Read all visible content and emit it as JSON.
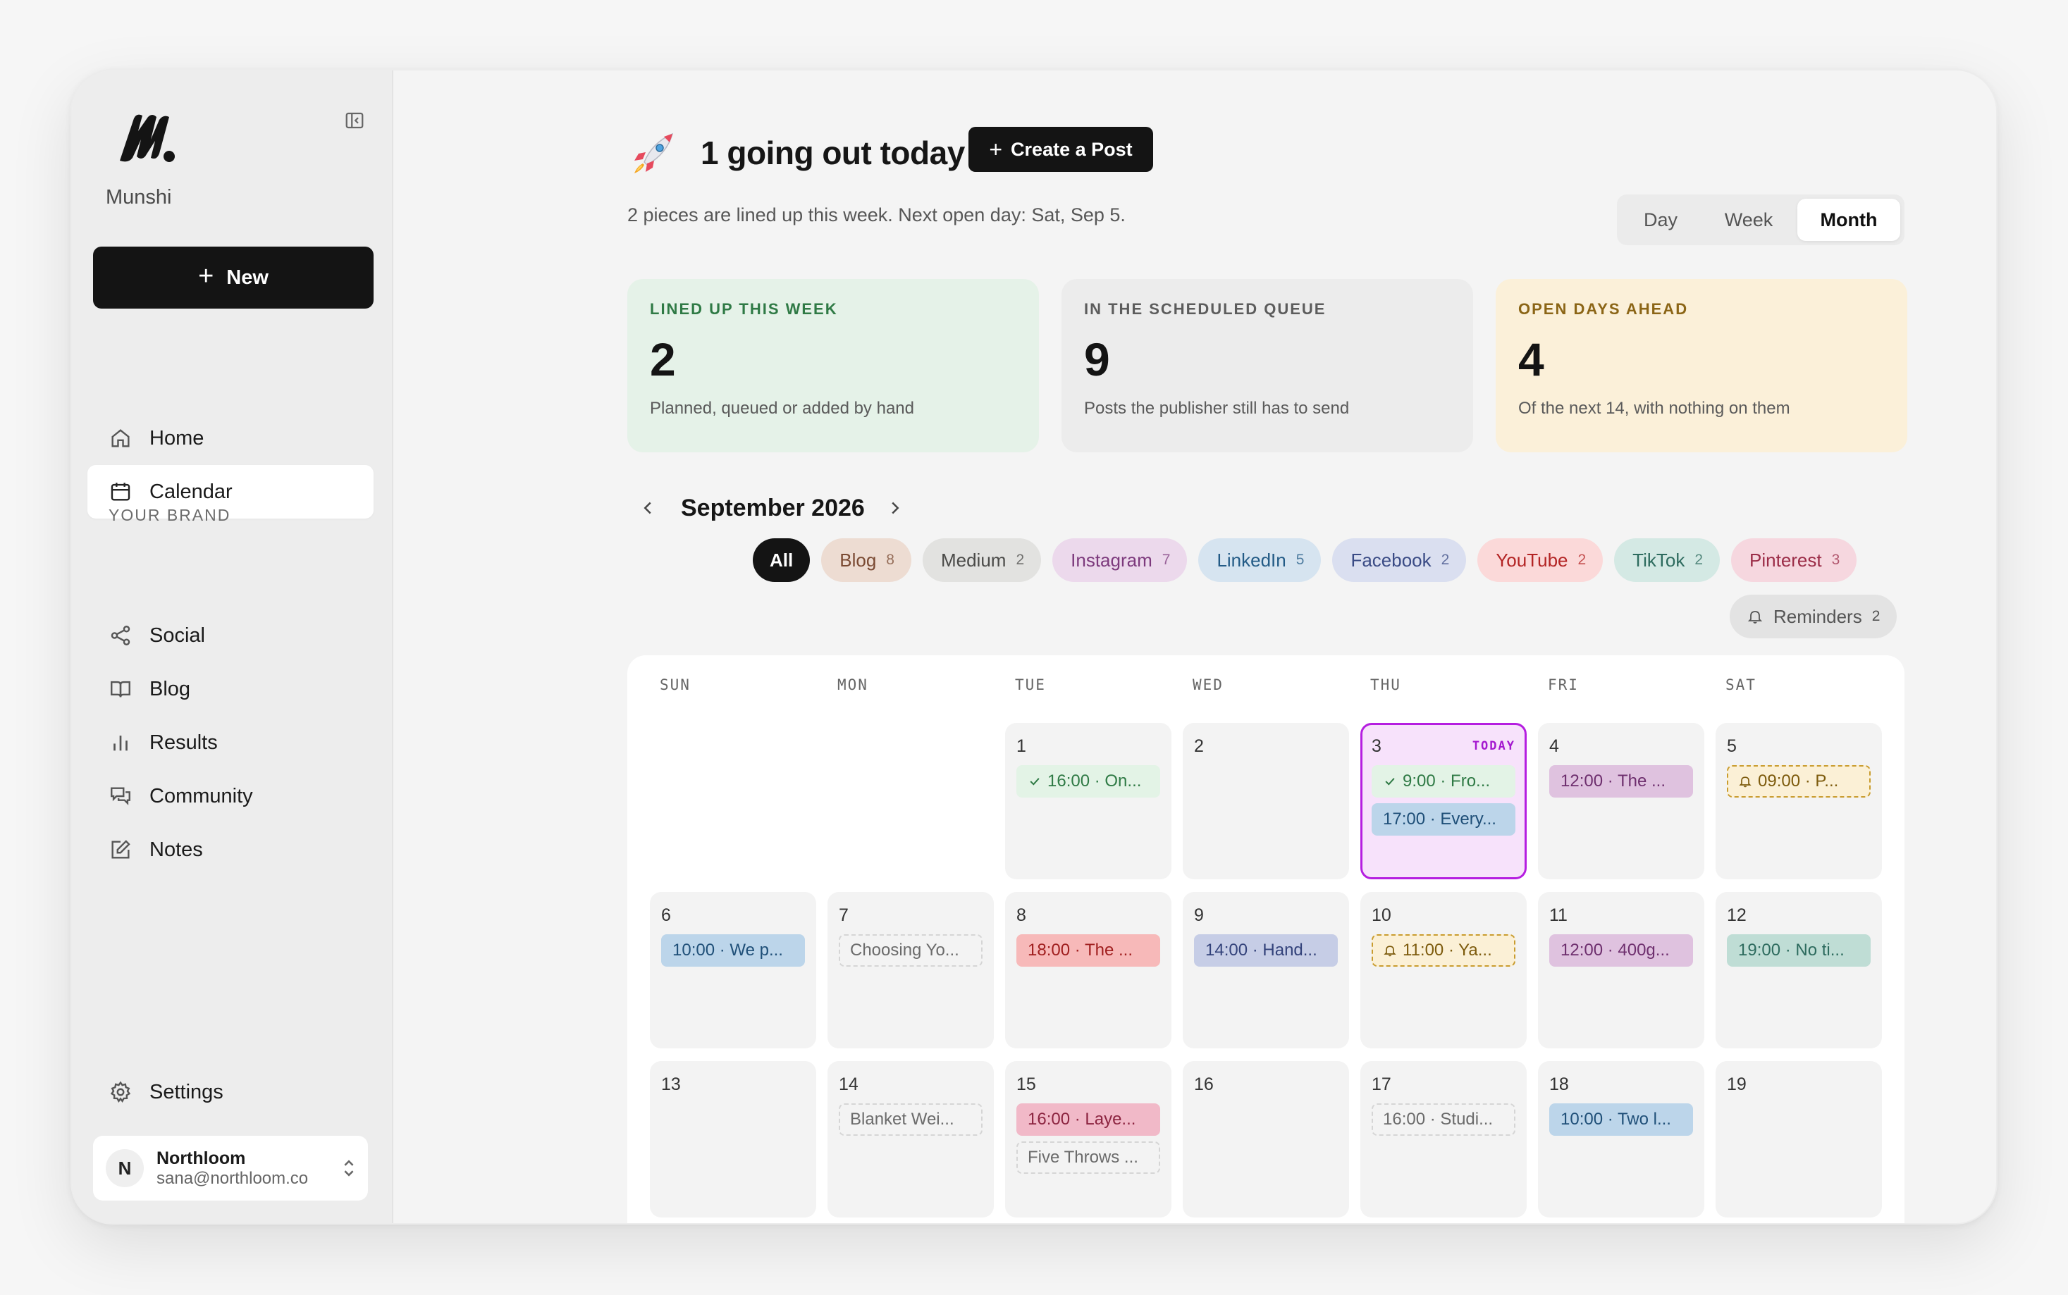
{
  "sidebar": {
    "brand_name": "Munshi",
    "new_label": "New",
    "nav": [
      {
        "label": "Home",
        "icon": "home-icon"
      },
      {
        "label": "Calendar",
        "icon": "calendar-icon",
        "active": true
      }
    ],
    "section_label": "YOUR BRAND",
    "brand_nav": [
      {
        "label": "Social",
        "icon": "share-icon"
      },
      {
        "label": "Blog",
        "icon": "book-icon"
      },
      {
        "label": "Results",
        "icon": "bar-chart-icon"
      },
      {
        "label": "Community",
        "icon": "chat-icon"
      },
      {
        "label": "Notes",
        "icon": "edit-icon"
      }
    ],
    "settings_label": "Settings",
    "account": {
      "initial": "N",
      "name": "Northloom",
      "email": "sana@northloom.co"
    }
  },
  "header": {
    "headline": "1 going out today",
    "create_label": "Create a Post",
    "subline": "2 pieces are lined up this week. Next open day: Sat, Sep 5.",
    "views": [
      "Day",
      "Week",
      "Month"
    ],
    "active_view": "Month"
  },
  "stats": [
    {
      "label": "LINED UP THIS WEEK",
      "value": "2",
      "desc": "Planned, queued or added by hand"
    },
    {
      "label": "IN THE SCHEDULED QUEUE",
      "value": "9",
      "desc": "Posts the publisher still has to send"
    },
    {
      "label": "OPEN DAYS AHEAD",
      "value": "4",
      "desc": "Of the next 14, with nothing on them"
    }
  ],
  "calendar": {
    "month_title": "September 2026",
    "filters": [
      {
        "label": "All",
        "count": "",
        "bg": "#141414",
        "fg": "#ffffff"
      },
      {
        "label": "Blog",
        "count": "8",
        "bg": "#eddcd2",
        "fg": "#7a4a33"
      },
      {
        "label": "Medium",
        "count": "2",
        "bg": "#e2e2e0",
        "fg": "#4a4a48"
      },
      {
        "label": "Instagram",
        "count": "7",
        "bg": "#ecd9ec",
        "fg": "#7d3a7d"
      },
      {
        "label": "LinkedIn",
        "count": "5",
        "bg": "#d6e4f0",
        "fg": "#235b86"
      },
      {
        "label": "Facebook",
        "count": "2",
        "bg": "#dadff0",
        "fg": "#3a4b85"
      },
      {
        "label": "YouTube",
        "count": "2",
        "bg": "#fbd9d9",
        "fg": "#b32424"
      },
      {
        "label": "TikTok",
        "count": "2",
        "bg": "#d4e9e4",
        "fg": "#2d6b5e"
      },
      {
        "label": "Pinterest",
        "count": "3",
        "bg": "#f6d7df",
        "fg": "#9b2c47"
      }
    ],
    "reminders": {
      "label": "Reminders",
      "count": "2"
    },
    "weekdays": [
      "SUN",
      "MON",
      "TUE",
      "WED",
      "THU",
      "FRI",
      "SAT"
    ],
    "today_tag": "TODAY",
    "weeks": [
      [
        null,
        null,
        {
          "day": "1",
          "events": [
            {
              "text": "16:00 · On...",
              "kind": "done",
              "bg": "#e3f3e6",
              "fg": "#2f7a45"
            }
          ]
        },
        {
          "day": "2",
          "events": []
        },
        {
          "day": "3",
          "today": true,
          "events": [
            {
              "text": "9:00 · Fro...",
              "kind": "done",
              "bg": "#e3f3e6",
              "fg": "#2f7a45"
            },
            {
              "text": "17:00 · Every...",
              "kind": "post",
              "bg": "#bcd5ea",
              "fg": "#1f4f78"
            }
          ]
        },
        {
          "day": "4",
          "events": [
            {
              "text": "12:00 · The ...",
              "kind": "post",
              "bg": "#dfc2df",
              "fg": "#6e2f6e"
            }
          ]
        },
        {
          "day": "5",
          "events": [
            {
              "text": "09:00 · P...",
              "kind": "reminder"
            }
          ]
        }
      ],
      [
        {
          "day": "6",
          "events": [
            {
              "text": "10:00 · We p...",
              "kind": "post",
              "bg": "#bcd5ea",
              "fg": "#1f4f78"
            }
          ]
        },
        {
          "day": "7",
          "events": [
            {
              "text": "Choosing Yo...",
              "kind": "draft"
            }
          ]
        },
        {
          "day": "8",
          "events": [
            {
              "text": "18:00 · The ...",
              "kind": "post",
              "bg": "#f7b9b9",
              "fg": "#a01e1e"
            }
          ]
        },
        {
          "day": "9",
          "events": [
            {
              "text": "14:00 · Hand...",
              "kind": "post",
              "bg": "#c6cde6",
              "fg": "#33427a"
            }
          ]
        },
        {
          "day": "10",
          "events": [
            {
              "text": "11:00 · Ya...",
              "kind": "reminder"
            }
          ]
        },
        {
          "day": "11",
          "events": [
            {
              "text": "12:00 · 400g...",
              "kind": "post",
              "bg": "#dfc2df",
              "fg": "#6e2f6e"
            }
          ]
        },
        {
          "day": "12",
          "events": [
            {
              "text": "19:00 · No ti...",
              "kind": "post",
              "bg": "#bfddd5",
              "fg": "#2d6b5e"
            }
          ]
        }
      ],
      [
        {
          "day": "13",
          "events": []
        },
        {
          "day": "14",
          "events": [
            {
              "text": "Blanket Wei...",
              "kind": "draft"
            }
          ]
        },
        {
          "day": "15",
          "events": [
            {
              "text": "16:00 · Laye...",
              "kind": "post",
              "bg": "#f1b9c8",
              "fg": "#8c2440"
            },
            {
              "text": "Five Throws ...",
              "kind": "draft"
            }
          ]
        },
        {
          "day": "16",
          "events": []
        },
        {
          "day": "17",
          "events": [
            {
              "text": "16:00 · Studi...",
              "kind": "draft"
            }
          ]
        },
        {
          "day": "18",
          "events": [
            {
              "text": "10:00 · Two l...",
              "kind": "post",
              "bg": "#bcd5ea",
              "fg": "#1f4f78"
            }
          ]
        },
        {
          "day": "19",
          "events": []
        }
      ]
    ]
  }
}
